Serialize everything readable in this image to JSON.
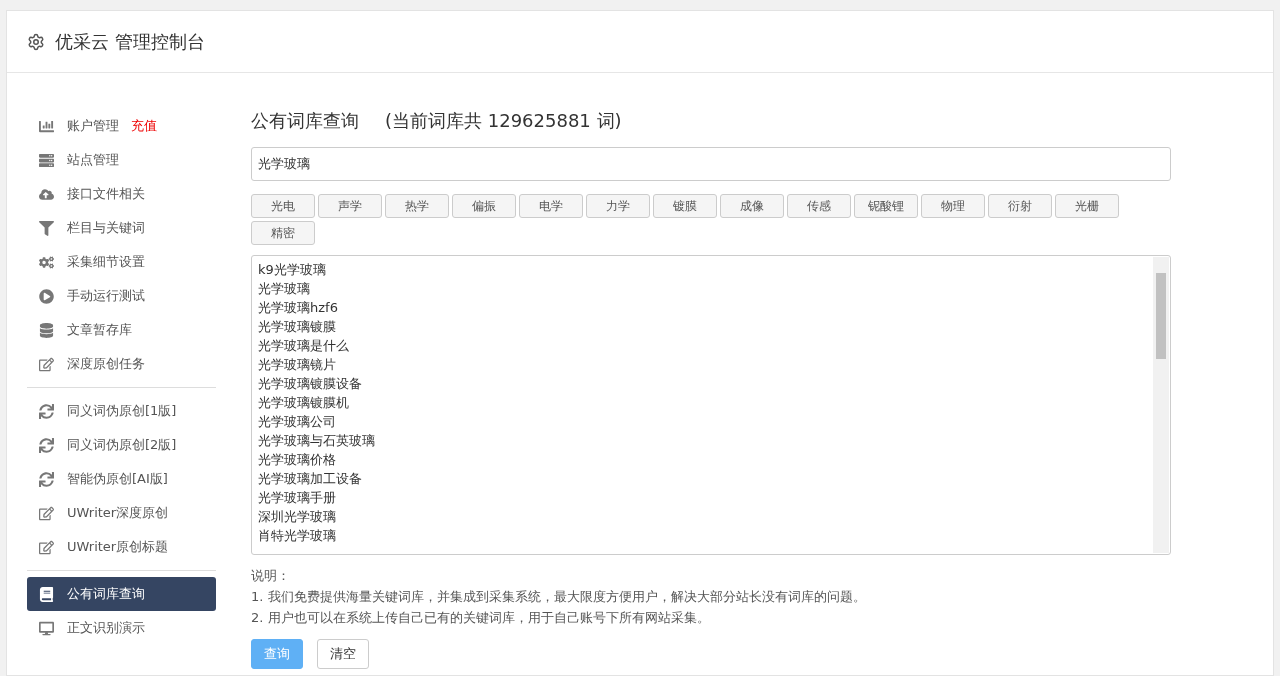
{
  "header": {
    "title": "优采云 管理控制台"
  },
  "sidebar": {
    "groups": [
      {
        "items": [
          {
            "label": "账户管理",
            "badge": "充值",
            "selected": false
          },
          {
            "label": "站点管理",
            "selected": false
          },
          {
            "label": "接口文件相关",
            "selected": false
          },
          {
            "label": "栏目与关键词",
            "selected": false
          },
          {
            "label": "采集细节设置",
            "selected": false
          },
          {
            "label": "手动运行测试",
            "selected": false
          },
          {
            "label": "文章暂存库",
            "selected": false
          },
          {
            "label": "深度原创任务",
            "selected": false
          }
        ]
      },
      {
        "items": [
          {
            "label": "同义词伪原创[1版]",
            "selected": false
          },
          {
            "label": "同义词伪原创[2版]",
            "selected": false
          },
          {
            "label": "智能伪原创[AI版]",
            "selected": false
          },
          {
            "label": "UWriter深度原创",
            "selected": false
          },
          {
            "label": "UWriter原创标题",
            "selected": false
          }
        ]
      },
      {
        "items": [
          {
            "label": "公有词库查询",
            "selected": true
          },
          {
            "label": "正文识别演示",
            "selected": false
          }
        ]
      }
    ]
  },
  "main": {
    "title": "公有词库查询",
    "count_note": "(当前词库共 129625881 词)",
    "search": {
      "value": "光学玻璃"
    },
    "tags": [
      "光电",
      "声学",
      "热学",
      "偏振",
      "电学",
      "力学",
      "镀膜",
      "成像",
      "传感",
      "铌酸锂",
      "物理",
      "衍射",
      "光栅",
      "精密"
    ],
    "results": [
      "k9光学玻璃",
      "光学玻璃",
      "光学玻璃hzf6",
      "光学玻璃镀膜",
      "光学玻璃是什么",
      "光学玻璃镜片",
      "光学玻璃镀膜设备",
      "光学玻璃镀膜机",
      "光学玻璃公司",
      "光学玻璃与石英玻璃",
      "光学玻璃价格",
      "光学玻璃加工设备",
      "光学玻璃手册",
      "深圳光学玻璃",
      "肖特光学玻璃"
    ],
    "notes_title": "说明：",
    "notes": [
      "1. 我们免费提供海量关键词库，并集成到采集系统，最大限度方便用户，解决大部分站长没有词库的问题。",
      "2. 用户也可以在系统上传自己已有的关键词库，用于自己账号下所有网站采集。"
    ],
    "buttons": [
      {
        "label": "查询",
        "kind": "primary"
      },
      {
        "label": "清空",
        "kind": "default"
      }
    ]
  }
}
